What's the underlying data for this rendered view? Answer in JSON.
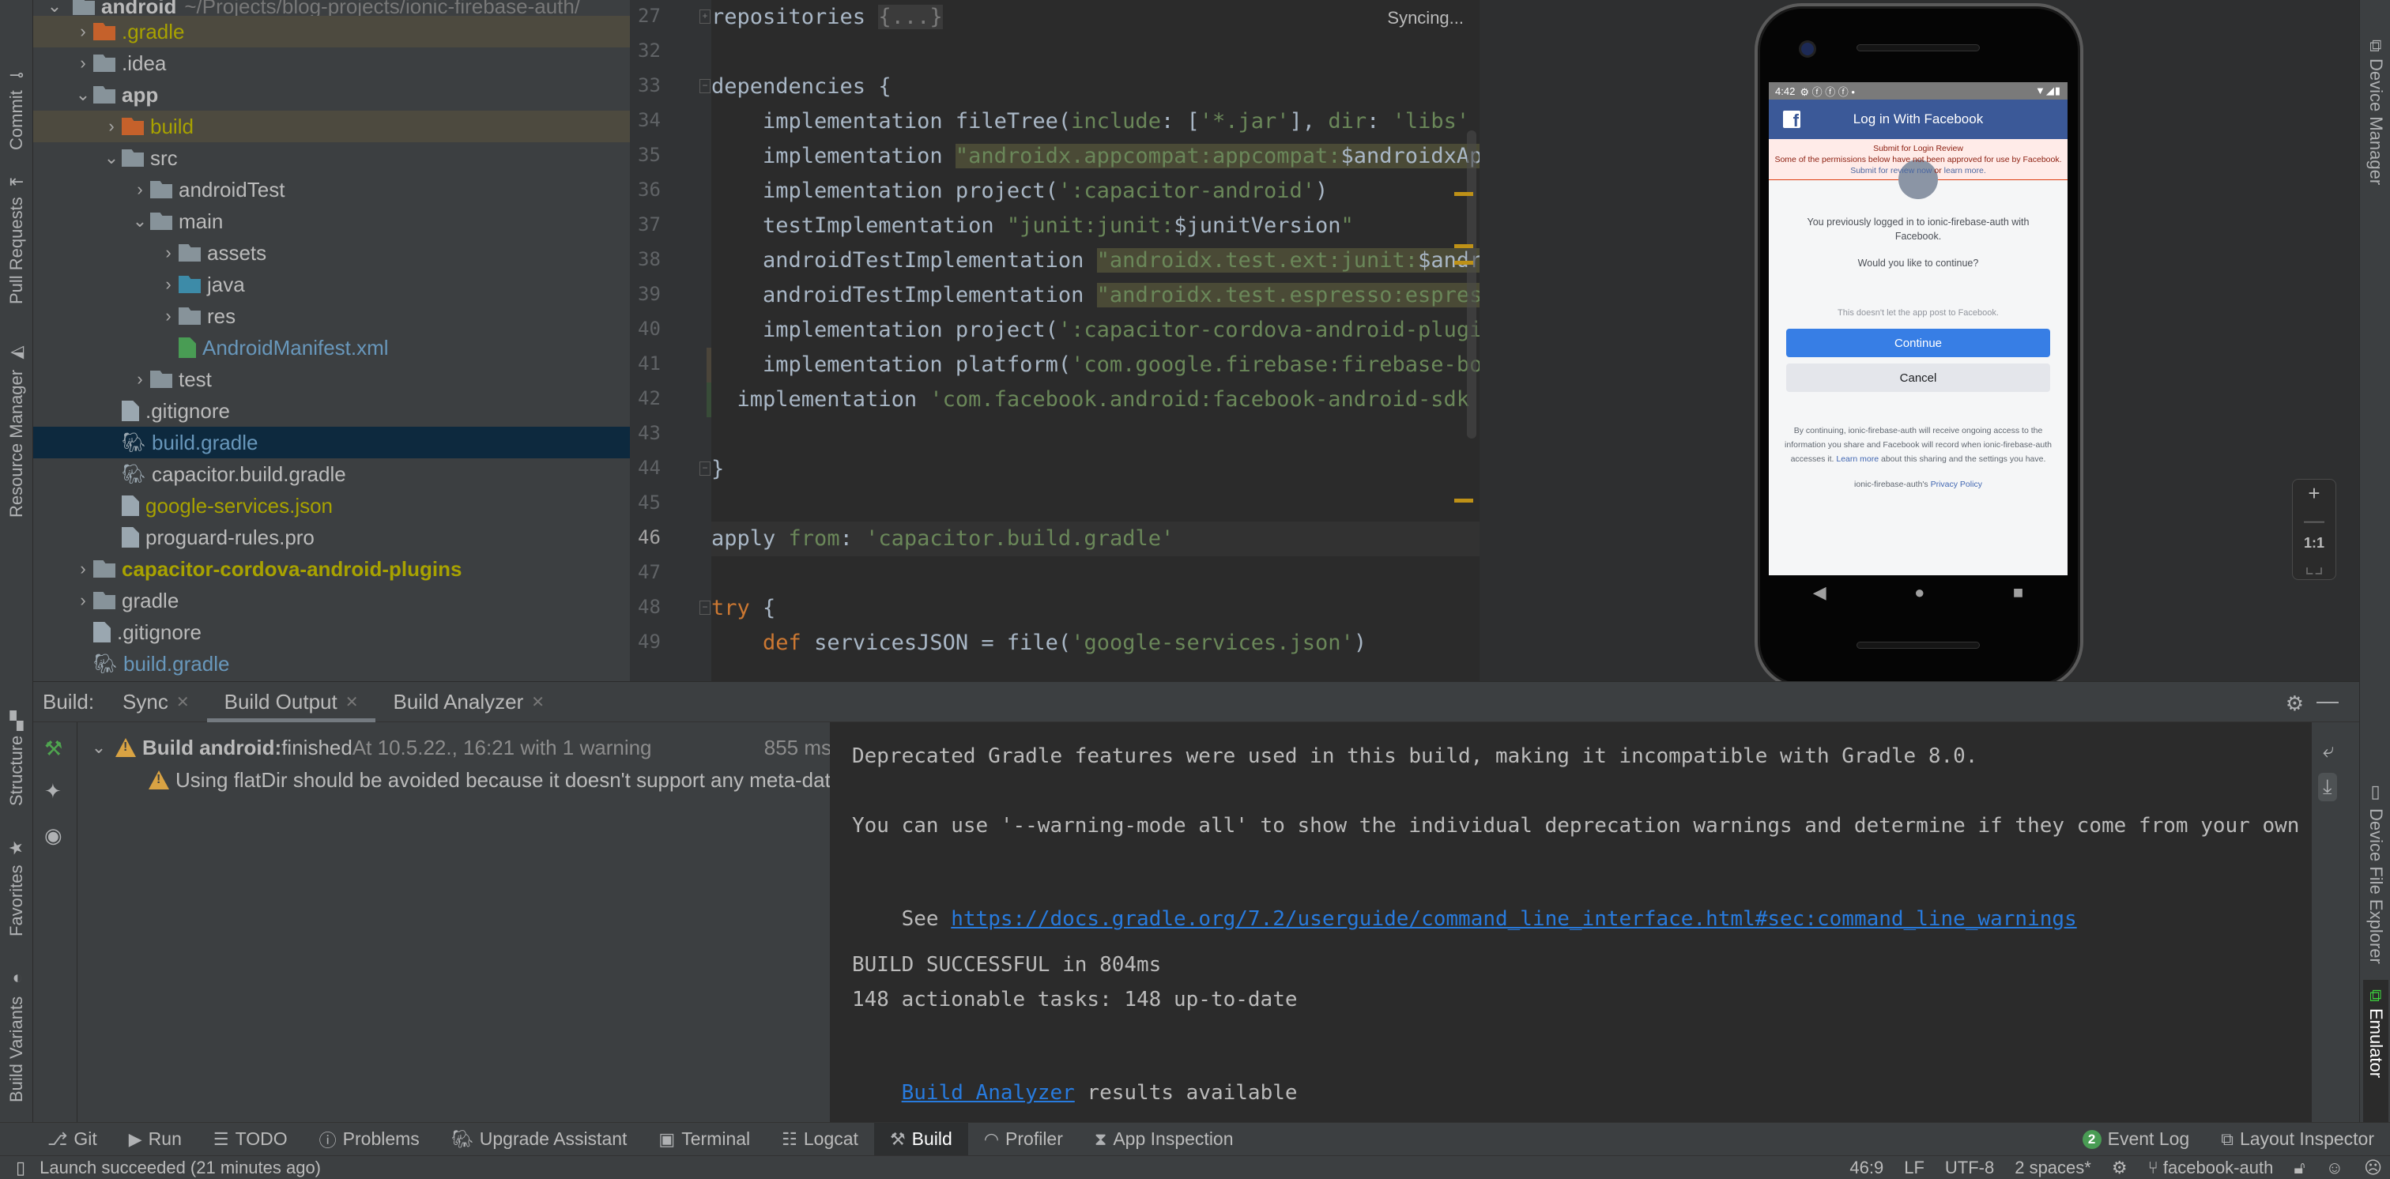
{
  "left_strip": {
    "tabs": [
      {
        "label": "Commit",
        "icon": "commit-icon"
      },
      {
        "label": "Pull Requests",
        "icon": "pull-request-icon"
      },
      {
        "label": "Resource Manager",
        "icon": "resource-manager-icon"
      },
      {
        "label": "Structure",
        "icon": "structure-icon"
      },
      {
        "label": "Favorites",
        "icon": "star-icon"
      },
      {
        "label": "Build Variants",
        "icon": "android-icon"
      }
    ]
  },
  "right_strip": {
    "tabs": [
      {
        "label": "Device Manager",
        "icon": "device-manager-icon"
      },
      {
        "label": "Device File Explorer",
        "icon": "phone-icon"
      },
      {
        "label": "Emulator",
        "icon": "emulator-icon"
      }
    ]
  },
  "project_tree": {
    "root": {
      "name": "android",
      "path": "~/Projects/blog-projects/ionic-firebase-auth/"
    },
    "items": [
      {
        "label": ".gradle",
        "type": "folder-excluded",
        "depth": 1,
        "expand": "collapsed",
        "color": "olive"
      },
      {
        "label": ".idea",
        "type": "folder",
        "depth": 1,
        "expand": "collapsed",
        "color": "default"
      },
      {
        "label": "app",
        "type": "module",
        "depth": 1,
        "expand": "expanded",
        "color": "bold"
      },
      {
        "label": "build",
        "type": "folder-excluded",
        "depth": 2,
        "expand": "collapsed",
        "color": "olive"
      },
      {
        "label": "src",
        "type": "folder",
        "depth": 2,
        "expand": "expanded",
        "color": "default"
      },
      {
        "label": "androidTest",
        "type": "folder",
        "depth": 3,
        "expand": "collapsed",
        "color": "default"
      },
      {
        "label": "main",
        "type": "folder",
        "depth": 3,
        "expand": "expanded",
        "color": "default"
      },
      {
        "label": "assets",
        "type": "folder-resources",
        "depth": 4,
        "expand": "collapsed",
        "color": "default"
      },
      {
        "label": "java",
        "type": "folder-source",
        "depth": 4,
        "expand": "collapsed",
        "color": "default"
      },
      {
        "label": "res",
        "type": "folder-resources",
        "depth": 4,
        "expand": "collapsed",
        "color": "default"
      },
      {
        "label": "AndroidManifest.xml",
        "type": "manifest",
        "depth": 4,
        "expand": "none",
        "color": "blue"
      },
      {
        "label": "test",
        "type": "folder",
        "depth": 3,
        "expand": "collapsed",
        "color": "default"
      },
      {
        "label": ".gitignore",
        "type": "file-ignore",
        "depth": 2,
        "expand": "none",
        "color": "default"
      },
      {
        "label": "build.gradle",
        "type": "gradle",
        "depth": 2,
        "expand": "none",
        "color": "blue",
        "selected": true
      },
      {
        "label": "capacitor.build.gradle",
        "type": "gradle",
        "depth": 2,
        "expand": "none",
        "color": "default"
      },
      {
        "label": "google-services.json",
        "type": "json",
        "depth": 2,
        "expand": "none",
        "color": "olive"
      },
      {
        "label": "proguard-rules.pro",
        "type": "file-text",
        "depth": 2,
        "expand": "none",
        "color": "default"
      },
      {
        "label": "capacitor-cordova-android-plugins",
        "type": "module-lib",
        "depth": 1,
        "expand": "collapsed",
        "color": "olive-bold"
      },
      {
        "label": "gradle",
        "type": "folder",
        "depth": 1,
        "expand": "collapsed",
        "color": "default"
      },
      {
        "label": ".gitignore",
        "type": "file-ignore",
        "depth": 1,
        "expand": "none",
        "color": "default"
      },
      {
        "label": "build.gradle",
        "type": "gradle",
        "depth": 1,
        "expand": "none",
        "color": "blue"
      }
    ]
  },
  "editor": {
    "status": "Syncing...",
    "current_line": 46,
    "lines": [
      {
        "num": 27,
        "segments": [
          {
            "t": "repositories ",
            "c": ""
          },
          {
            "t": "{...}",
            "c": "fold-ph"
          }
        ],
        "fold": "plus"
      },
      {
        "num": 32,
        "segments": []
      },
      {
        "num": 33,
        "segments": [
          {
            "t": "dependencies {",
            "c": ""
          }
        ],
        "fold": "minus"
      },
      {
        "num": 34,
        "segments": [
          {
            "t": "    implementation fileTree(",
            "c": ""
          },
          {
            "t": "include",
            "c": "named"
          },
          {
            "t": ": [",
            "c": ""
          },
          {
            "t": "'*.jar'",
            "c": "str"
          },
          {
            "t": "], ",
            "c": ""
          },
          {
            "t": "dir",
            "c": "named"
          },
          {
            "t": ": ",
            "c": ""
          },
          {
            "t": "'libs'",
            "c": "str"
          }
        ]
      },
      {
        "num": 35,
        "segments": [
          {
            "t": "    implementation ",
            "c": ""
          },
          {
            "t": "\"androidx.appcompat:appcompat:",
            "c": "str hl"
          },
          {
            "t": "$androidxAppCompatVersion",
            "c": "hl"
          }
        ]
      },
      {
        "num": 36,
        "segments": [
          {
            "t": "    implementation project(",
            "c": ""
          },
          {
            "t": "':capacitor-android'",
            "c": "str"
          },
          {
            "t": ")",
            "c": ""
          }
        ]
      },
      {
        "num": 37,
        "segments": [
          {
            "t": "    testImplementation ",
            "c": ""
          },
          {
            "t": "\"junit:junit:",
            "c": "str"
          },
          {
            "t": "$junitVersion",
            "c": ""
          },
          {
            "t": "\"",
            "c": "str"
          }
        ]
      },
      {
        "num": 38,
        "segments": [
          {
            "t": "    androidTestImplementation ",
            "c": ""
          },
          {
            "t": "\"androidx.test.ext:junit:",
            "c": "str hl"
          },
          {
            "t": "$androidxJunitVersion",
            "c": "hl"
          }
        ]
      },
      {
        "num": 39,
        "segments": [
          {
            "t": "    androidTestImplementation ",
            "c": ""
          },
          {
            "t": "\"androidx.test.espresso:espresso-core:",
            "c": "str hl"
          }
        ]
      },
      {
        "num": 40,
        "segments": [
          {
            "t": "    implementation project(",
            "c": ""
          },
          {
            "t": "':capacitor-cordova-android-plugins'",
            "c": "str"
          }
        ]
      },
      {
        "num": 41,
        "segments": [
          {
            "t": "    implementation platform(",
            "c": ""
          },
          {
            "t": "'com.google.firebase:firebase-bom",
            "c": "str"
          }
        ],
        "vcs": "modified"
      },
      {
        "num": 42,
        "segments": [
          {
            "t": "  implementation ",
            "c": ""
          },
          {
            "t": "'com.facebook.android:facebook-android-sdk",
            "c": "str"
          }
        ],
        "vcs": "added"
      },
      {
        "num": 43,
        "segments": []
      },
      {
        "num": 44,
        "segments": [
          {
            "t": "}",
            "c": ""
          }
        ],
        "fold": "end"
      },
      {
        "num": 45,
        "segments": []
      },
      {
        "num": 46,
        "segments": [
          {
            "t": "apply ",
            "c": ""
          },
          {
            "t": "from",
            "c": "named"
          },
          {
            "t": ": ",
            "c": ""
          },
          {
            "t": "'capacitor.build.gradle'",
            "c": "str"
          }
        ]
      },
      {
        "num": 47,
        "segments": []
      },
      {
        "num": 48,
        "segments": [
          {
            "t": "try",
            "c": "kw"
          },
          {
            "t": " {",
            "c": ""
          }
        ],
        "fold": "minus"
      },
      {
        "num": 49,
        "segments": [
          {
            "t": "    ",
            "c": ""
          },
          {
            "t": "def",
            "c": "kw"
          },
          {
            "t": " servicesJSON = file(",
            "c": ""
          },
          {
            "t": "'google-services.json'",
            "c": "str"
          },
          {
            "t": ")",
            "c": ""
          }
        ]
      }
    ]
  },
  "emulator": {
    "status_bar": {
      "time": "4:42",
      "left_icons": "⚙ ⓕ ⓕ ⓕ •",
      "right_icons": "▼◢▮"
    },
    "header_title": "Log in With Facebook",
    "review_banner": {
      "title": "Submit for Login Review",
      "body": "Some of the permissions below have not been approved for use by Facebook.",
      "link1": "Submit for review now",
      "joiner": " or ",
      "link2": "learn more."
    },
    "previously_logged": "You previously logged in to ionic-firebase-auth with Facebook.",
    "question": "Would you like to continue?",
    "no_post_note": "This doesn't let the app post to Facebook.",
    "continue_label": "Continue",
    "cancel_label": "Cancel",
    "disclaimer_pre": "By continuing, ionic-firebase-auth will receive ongoing access to the information you share and Facebook will record when ionic-firebase-auth accesses it. ",
    "disclaimer_link": "Learn more",
    "disclaimer_post": " about this sharing and the settings you have.",
    "privacy_pre": "ionic-firebase-auth's ",
    "privacy_link": "Privacy Policy",
    "zoom_controls": {
      "zoom_in": "+",
      "zoom_out": "—",
      "actual": "1:1",
      "fit": "⌞⌟"
    }
  },
  "build_panel": {
    "label": "Build:",
    "tabs": [
      {
        "label": "Sync",
        "active": false
      },
      {
        "label": "Build Output",
        "active": true
      },
      {
        "label": "Build Analyzer",
        "active": false
      }
    ],
    "tree": {
      "root_title": "Build android:",
      "root_status": " finished",
      "root_detail": " At 10.5.22., 16:21 with 1 warning",
      "root_duration": "855 ms",
      "warning": "Using flatDir should be avoided because it doesn't support any meta-data formats."
    },
    "output": {
      "line1": "Deprecated Gradle features were used in this build, making it incompatible with Gradle 8.0.",
      "line2": "You can use '--warning-mode all' to show the individual deprecation warnings and determine if they come from your own scripts or plugins.",
      "line3_pre": "See ",
      "line3_link": "https://docs.gradle.org/7.2/userguide/command_line_interface.html#sec:command_line_warnings",
      "line4": "BUILD SUCCESSFUL in 804ms",
      "line5": "148 actionable tasks: 148 up-to-date",
      "line6_link": "Build Analyzer",
      "line6_post": " results available"
    }
  },
  "tool_windows": {
    "left": [
      {
        "label": "Git",
        "icon": "git-icon"
      },
      {
        "label": "Run",
        "icon": "run-icon"
      },
      {
        "label": "TODO",
        "icon": "todo-icon"
      },
      {
        "label": "Problems",
        "icon": "problems-icon"
      },
      {
        "label": "Upgrade Assistant",
        "icon": "upgrade-assistant-icon"
      },
      {
        "label": "Terminal",
        "icon": "terminal-icon"
      },
      {
        "label": "Logcat",
        "icon": "logcat-icon"
      },
      {
        "label": "Build",
        "icon": "hammer-icon",
        "active": true
      },
      {
        "label": "Profiler",
        "icon": "profiler-icon"
      },
      {
        "label": "App Inspection",
        "icon": "app-inspection-icon"
      }
    ],
    "right": [
      {
        "label": "Event Log",
        "badge": "2"
      },
      {
        "label": "Layout Inspector",
        "icon": "layout-inspector-icon"
      }
    ]
  },
  "status_bar": {
    "message": "Launch succeeded (21 minutes ago)",
    "position": "46:9",
    "line_sep": "LF",
    "encoding": "UTF-8",
    "indent": "2 spaces*",
    "branch": "facebook-auth"
  }
}
